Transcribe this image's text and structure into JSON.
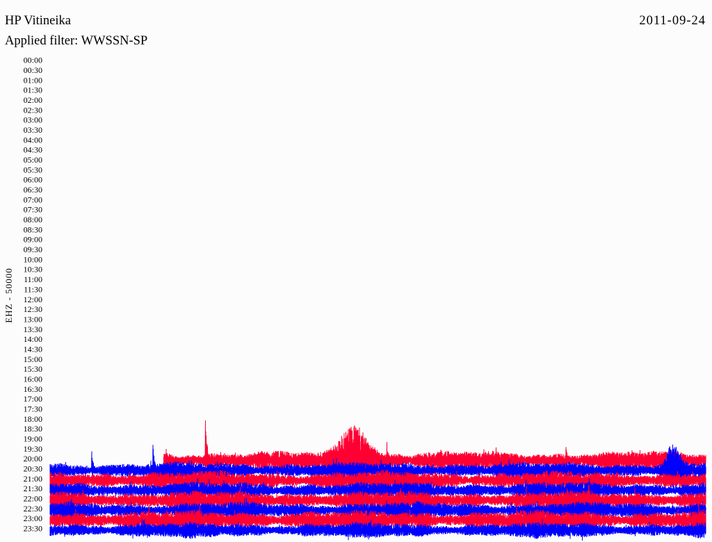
{
  "chart_data": {
    "type": "line",
    "title": "HP Vitineika",
    "date": "2011-09-24",
    "subtitle": "Applied filter: WWSSN-SP",
    "ylabel": "EHZ - 50000",
    "grid": false,
    "y_tick_labels": [
      "00:00",
      "00:30",
      "01:00",
      "01:30",
      "02:00",
      "02:30",
      "03:00",
      "03:30",
      "04:00",
      "04:30",
      "05:00",
      "05:30",
      "06:00",
      "06:30",
      "07:00",
      "07:30",
      "08:00",
      "08:30",
      "09:00",
      "09:30",
      "10:00",
      "10:30",
      "11:00",
      "11:30",
      "12:00",
      "12:30",
      "13:00",
      "13:30",
      "14:00",
      "14:30",
      "15:00",
      "15:30",
      "16:00",
      "16:30",
      "17:00",
      "17:30",
      "18:00",
      "18:30",
      "19:00",
      "19:30",
      "20:00",
      "20:30",
      "21:00",
      "21:30",
      "22:00",
      "22:30",
      "23:00",
      "23:30"
    ],
    "traces": [
      {
        "row": "20:00",
        "color": "#ff0033",
        "start_minute": 5.2,
        "noise": 0.85
      },
      {
        "row": "20:30",
        "color": "#0000ff",
        "noise": 0.75
      },
      {
        "row": "21:00",
        "color": "#ff0033",
        "noise": 0.85
      },
      {
        "row": "21:30",
        "color": "#0000ff",
        "noise": 0.75
      },
      {
        "row": "22:00",
        "color": "#ff0033",
        "noise": 0.85
      },
      {
        "row": "22:30",
        "color": "#0000ff",
        "noise": 0.75
      },
      {
        "row": "23:00",
        "color": "#ff0033",
        "noise": 0.9
      },
      {
        "row": "23:30",
        "color": "#0000ff",
        "noise": 0.7
      }
    ],
    "events": [
      {
        "row": "20:00",
        "minute": 5.3,
        "peak": 1.3
      },
      {
        "row": "20:00",
        "minute": 7.1,
        "peak": 4.4
      },
      {
        "row": "20:00",
        "minute": 13.9,
        "peak": 3.8,
        "duration": 2.2
      },
      {
        "row": "20:00",
        "minute": 15.4,
        "peak": 2.1
      },
      {
        "row": "20:00",
        "minute": 20.4,
        "peak": 1.4
      },
      {
        "row": "20:00",
        "minute": 23.6,
        "peak": 1.4
      },
      {
        "row": "20:30",
        "minute": 1.9,
        "peak": 2.1
      },
      {
        "row": "20:30",
        "minute": 4.7,
        "peak": 2.8
      },
      {
        "row": "20:30",
        "minute": 28.5,
        "peak": 3.1,
        "duration": 1.0
      }
    ]
  }
}
